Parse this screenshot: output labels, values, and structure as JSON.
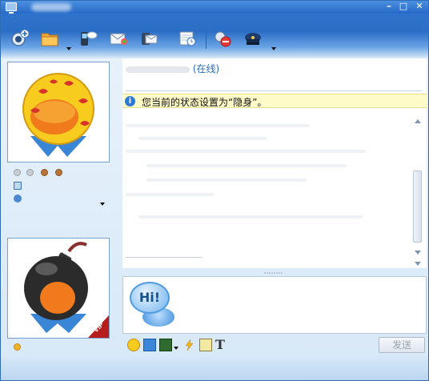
{
  "window": {
    "title": "",
    "min_label": "–",
    "max_label": "□",
    "close_label": "✕"
  },
  "toolbar": {
    "items": [
      {
        "name": "video-chat",
        "icon": "camera-plus-icon"
      },
      {
        "name": "send-file",
        "icon": "folder-icon"
      },
      {
        "name": "mobile-sms",
        "icon": "phone-icon"
      },
      {
        "name": "mail",
        "icon": "envelope-icon"
      },
      {
        "name": "send-message",
        "icon": "message-card-icon"
      },
      {
        "name": "history",
        "icon": "calendar-clock-icon"
      },
      {
        "name": "block",
        "icon": "no-entry-icon"
      },
      {
        "name": "security",
        "icon": "police-hat-icon"
      }
    ]
  },
  "contact": {
    "status": "(在线)"
  },
  "notice": {
    "text": "您当前的状态设置为“隐身”。"
  },
  "input": {
    "hi_text": "Hi!"
  },
  "buttons": {
    "send": "发送"
  },
  "colors": {
    "toolbar_top": "#2f73cc",
    "notice_bg": "#fffbc8",
    "link_blue": "#2a6bb5",
    "info_blue": "#2b78d6"
  }
}
